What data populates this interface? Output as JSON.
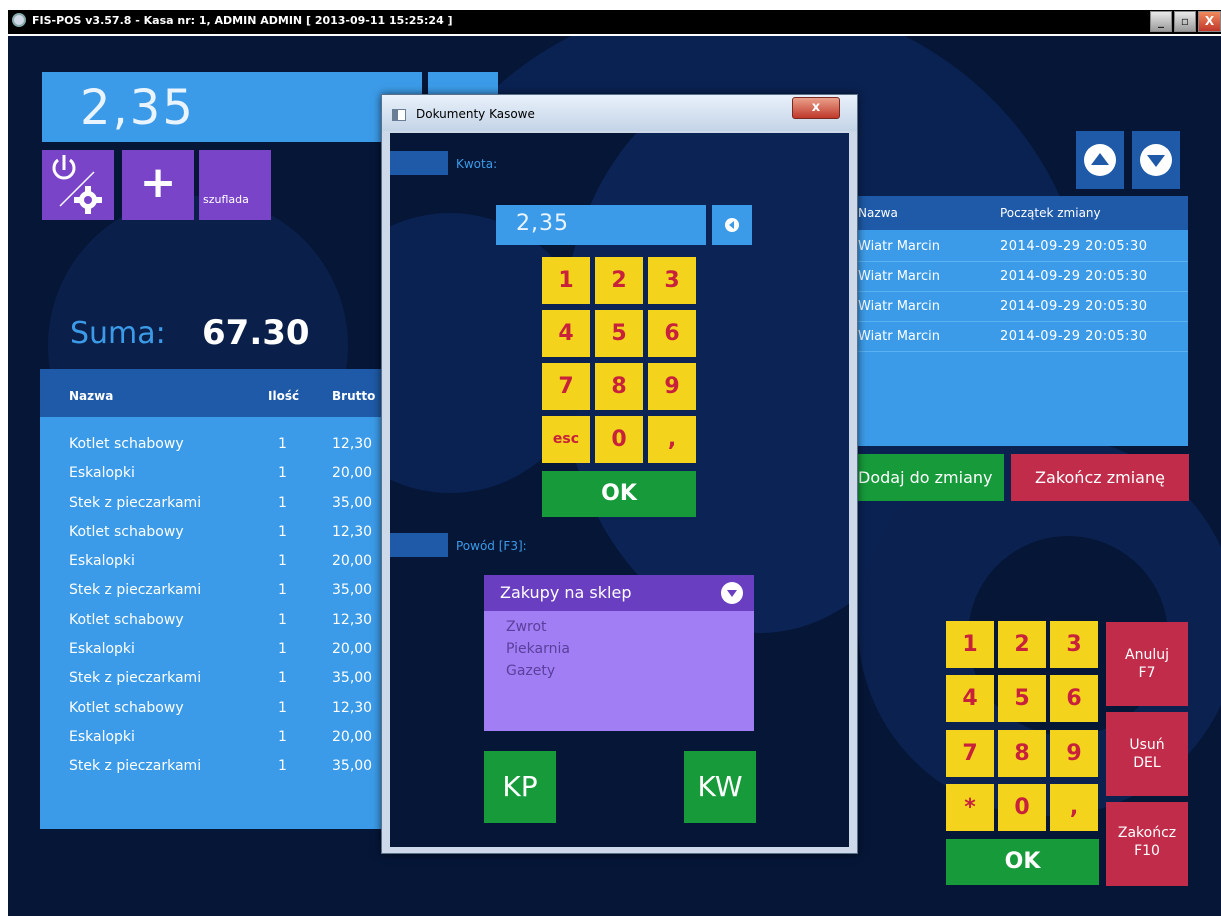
{
  "window": {
    "title": "FIS-POS v3.57.8 - Kasa nr: 1, ADMIN ADMIN [ 2013-09-11 15:25:24 ]",
    "min_icon": "minimize-icon",
    "max_icon": "maximize-icon",
    "close_label": "X"
  },
  "main": {
    "amount": "2,35",
    "szuflada_label": "szuflada",
    "plus_label": "+",
    "suma_label": "Suma:",
    "suma_value": "67.30",
    "columns": {
      "name": "Nazwa",
      "qty": "Ilość",
      "brutto": "Brutto"
    },
    "items": [
      {
        "name": "Kotlet schabowy",
        "qty": "1",
        "brutto": "12,30"
      },
      {
        "name": "Eskalopki",
        "qty": "1",
        "brutto": "20,00"
      },
      {
        "name": "Stek z pieczarkami",
        "qty": "1",
        "brutto": "35,00"
      },
      {
        "name": "Kotlet schabowy",
        "qty": "1",
        "brutto": "12,30"
      },
      {
        "name": "Eskalopki",
        "qty": "1",
        "brutto": "20,00"
      },
      {
        "name": "Stek z pieczarkami",
        "qty": "1",
        "brutto": "35,00"
      },
      {
        "name": "Kotlet schabowy",
        "qty": "1",
        "brutto": "12,30"
      },
      {
        "name": "Eskalopki",
        "qty": "1",
        "brutto": "20,00"
      },
      {
        "name": "Stek z pieczarkami",
        "qty": "1",
        "brutto": "35,00"
      },
      {
        "name": "Kotlet schabowy",
        "qty": "1",
        "brutto": "12,30"
      },
      {
        "name": "Eskalopki",
        "qty": "1",
        "brutto": "20,00"
      },
      {
        "name": "Stek z pieczarkami",
        "qty": "1",
        "brutto": "35,00"
      }
    ]
  },
  "shifts": {
    "columns": {
      "name": "Nazwa",
      "start": "Początek zmiany"
    },
    "rows": [
      {
        "name": "Wiatr Marcin",
        "start": "2014-09-29 20:05:30"
      },
      {
        "name": "Wiatr Marcin",
        "start": "2014-09-29 20:05:30"
      },
      {
        "name": "Wiatr Marcin",
        "start": "2014-09-29 20:05:30"
      },
      {
        "name": "Wiatr Marcin",
        "start": "2014-09-29 20:05:30"
      }
    ],
    "add_label": "Dodaj do zmiany",
    "end_label": "Zakończ zmianę"
  },
  "right_pad": {
    "keys": [
      "1",
      "2",
      "3",
      "4",
      "5",
      "6",
      "7",
      "8",
      "9",
      "*",
      "0",
      ","
    ],
    "anuluj_label": "Anuluj\nF7",
    "usun_label": "Usuń\nDEL",
    "zakoncz_label": "Zakończ\nF10",
    "ok_label": "OK"
  },
  "dialog": {
    "title": "Dokumenty Kasowe",
    "close_label": "x",
    "kwota_label": "Kwota:",
    "amount": "2,35",
    "keys": [
      "1",
      "2",
      "3",
      "4",
      "5",
      "6",
      "7",
      "8",
      "9",
      "esc",
      "0",
      ","
    ],
    "ok_label": "OK",
    "powod_label": "Powód [F3]:",
    "selected": "Zakupy na sklep",
    "options": [
      "Zwrot",
      "Piekarnia",
      "Gazety"
    ],
    "kp_label": "KP",
    "kw_label": "KW"
  },
  "colors": {
    "background": "#061637",
    "accent_blue": "#3c9be8",
    "header_blue": "#1e5aa7",
    "purple": "#7a44c9",
    "key_yellow": "#f4d31c",
    "key_text_red": "#c8213b",
    "ok_green": "#169a3a",
    "action_red": "#c02c4a"
  }
}
